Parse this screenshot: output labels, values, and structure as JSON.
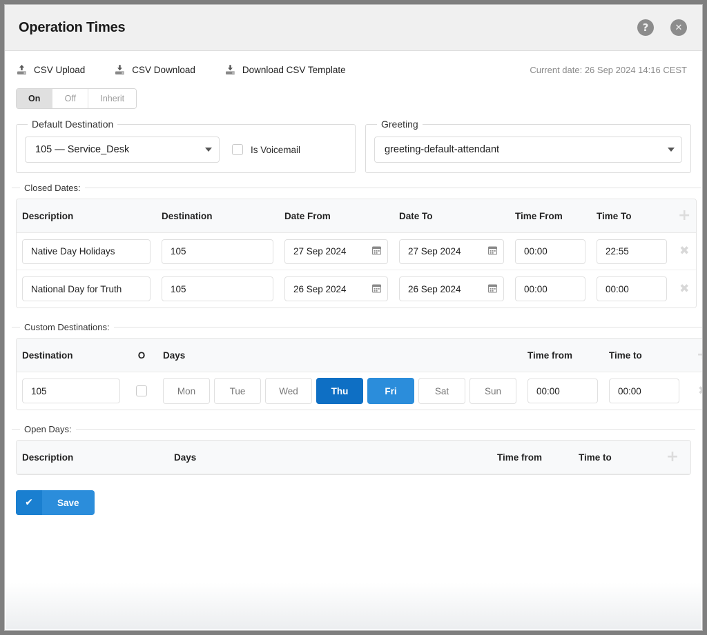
{
  "header": {
    "title": "Operation Times",
    "help_icon": "question-circle-icon",
    "close_icon": "close-circle-icon",
    "help_glyph": "?",
    "close_glyph": "✕"
  },
  "toolbar": {
    "csv_upload": "CSV Upload",
    "csv_download": "CSV Download",
    "download_template": "Download CSV Template",
    "current_date": "Current date: 26 Sep 2024 14:16 CEST"
  },
  "state_toggle": {
    "options": [
      "On",
      "Off",
      "Inherit"
    ],
    "selected": "On"
  },
  "default_destination": {
    "legend": "Default Destination",
    "value": "105  —  Service_Desk",
    "is_voicemail_label": "Is Voicemail",
    "is_voicemail_checked": false
  },
  "greeting": {
    "legend": "Greeting",
    "value": "greeting-default-attendant"
  },
  "closed_dates": {
    "legend": "Closed Dates:",
    "columns": [
      "Description",
      "Destination",
      "Date From",
      "Date To",
      "Time From",
      "Time To"
    ],
    "add_glyph": "+",
    "remove_glyph": "✖",
    "rows": [
      {
        "description": "Native Day Holidays",
        "destination": "105",
        "date_from": "27 Sep 2024",
        "date_to": "27 Sep 2024",
        "time_from": "00:00",
        "time_to": "22:55"
      },
      {
        "description": "National Day for Truth",
        "destination": "105",
        "date_from": "26 Sep 2024",
        "date_to": "26 Sep 2024",
        "time_from": "00:00",
        "time_to": "00:00"
      }
    ]
  },
  "custom_destinations": {
    "legend": "Custom Destinations:",
    "columns": [
      "Destination",
      "O",
      "Days",
      "Time from",
      "Time to"
    ],
    "add_glyph": "+",
    "remove_glyph": "✖",
    "rows": [
      {
        "destination": "105",
        "o_checked": false,
        "days": [
          {
            "label": "Mon",
            "selected": false
          },
          {
            "label": "Tue",
            "selected": false
          },
          {
            "label": "Wed",
            "selected": false
          },
          {
            "label": "Thu",
            "selected": true
          },
          {
            "label": "Fri",
            "selected": true
          },
          {
            "label": "Sat",
            "selected": false
          },
          {
            "label": "Sun",
            "selected": false
          }
        ],
        "time_from": "00:00",
        "time_to": "00:00"
      }
    ]
  },
  "open_days": {
    "legend": "Open Days:",
    "columns": [
      "Description",
      "Days",
      "Time from",
      "Time to"
    ],
    "add_glyph": "+",
    "rows": []
  },
  "save": {
    "label": "Save",
    "check_glyph": "✔"
  },
  "colors": {
    "accent": "#2b8ddb",
    "accent_dark": "#0e6fc4",
    "header_bg": "#f0f0f0",
    "table_head_bg": "#f8f9fa",
    "muted": "#8a8a8a"
  }
}
